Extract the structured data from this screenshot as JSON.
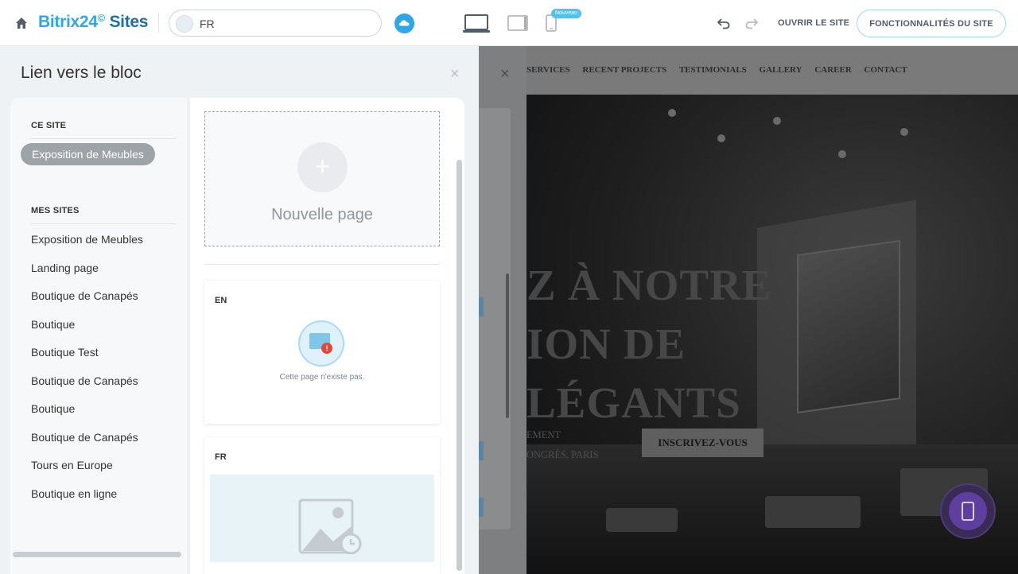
{
  "topbar": {
    "logo_brand": "Bitrix24",
    "logo_mark": "©",
    "logo_suffix": "Sites",
    "site_selector_value": "FR",
    "new_badge": "Nouveau",
    "open_site": "OUVRIR LE SITE",
    "features_button": "FONCTIONNALITÉS DU SITE"
  },
  "panel": {
    "title": "Lien vers le bloc",
    "close_icon": "×",
    "sidebar": {
      "this_site_heading": "CE SITE",
      "this_site_item": "Exposition de Meubles",
      "my_sites_heading": "MES SITES",
      "my_sites": [
        "Exposition de Meubles",
        "Landing page",
        "Boutique de Canapés",
        "Boutique",
        "Boutique Test",
        "Boutique de Canapés",
        "Boutique",
        "Boutique de Canapés",
        "Tours en Europe",
        "Boutique en ligne"
      ]
    },
    "content": {
      "new_page_label": "Nouvelle page",
      "new_page_icon": "+",
      "pages": [
        {
          "code": "EN",
          "preview_text": "Cette page n'existe pas."
        },
        {
          "code": "FR"
        }
      ]
    }
  },
  "preview": {
    "close_icon": "×",
    "nav_items": [
      "SERVICES",
      "RECENT PROJECTS",
      "TESTIMONIALS",
      "GALLERY",
      "CAREER",
      "CONTACT"
    ],
    "hero_lines": [
      "Z À NOTRE",
      "ION DE",
      "LÉGANTS"
    ],
    "hero_sub_lines": [
      "EMENT",
      "ONGRÈS, PARIS"
    ],
    "cta": "INSCRIVEZ-VOUS"
  },
  "icons": {
    "home": "home-icon",
    "cloud": "cloud-icon",
    "laptop": "laptop-icon",
    "tablet": "tablet-icon",
    "phone": "phone-icon",
    "undo": "undo-icon",
    "redo": "redo-icon",
    "image_placeholder": "image-placeholder-icon"
  },
  "colors": {
    "accent": "#2fa7e6",
    "pill": "#9ea3a8",
    "fab": "#5f3f9e"
  }
}
